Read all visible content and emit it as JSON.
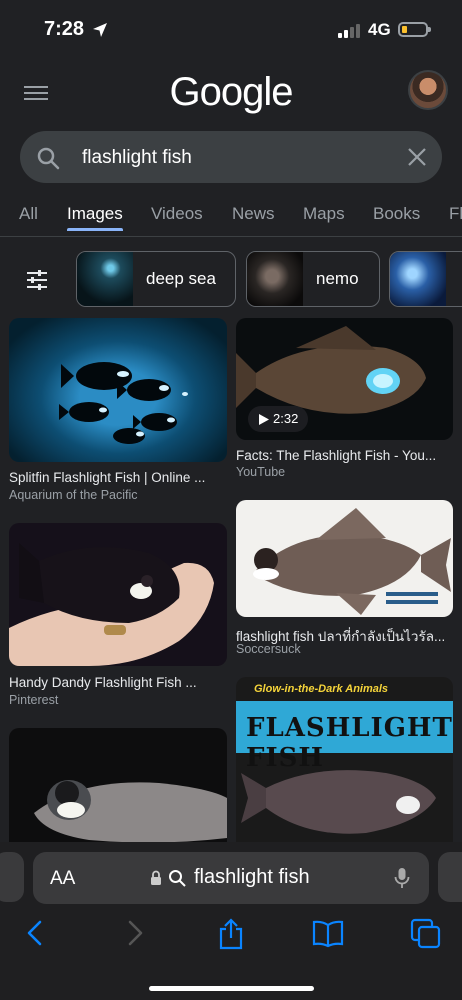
{
  "status": {
    "time": "7:28",
    "network": "4G"
  },
  "header": {
    "logo": "Google"
  },
  "search": {
    "query": "flashlight fish"
  },
  "tabs": [
    {
      "label": "All"
    },
    {
      "label": "Images",
      "active": true
    },
    {
      "label": "Videos"
    },
    {
      "label": "News"
    },
    {
      "label": "Maps"
    },
    {
      "label": "Books"
    },
    {
      "label": "Fl"
    }
  ],
  "chips": [
    {
      "label": "deep sea"
    },
    {
      "label": "nemo"
    }
  ],
  "results": [
    {
      "title": "Splitfin Flashlight Fish | Online ...",
      "source": "Aquarium of the Pacific"
    },
    {
      "title": "Facts: The Flashlight Fish - You...",
      "source": "YouTube",
      "duration": "2:32"
    },
    {
      "title": "Handy Dandy Flashlight Fish ...",
      "source": "Pinterest"
    },
    {
      "title": "flashlight fish ปลาที่กำลังเป็นไวรัล...",
      "source": "Soccersuck"
    },
    {
      "image_text": "FLASHLIGHT FISH",
      "image_caption": "Glow-in-the-Dark Animals"
    }
  ],
  "safari": {
    "aa": "AA",
    "url": "flashlight fish"
  },
  "colors": {
    "background": "#202124",
    "accent": "#8ab4f8",
    "safari_tint": "#0a84ff"
  }
}
